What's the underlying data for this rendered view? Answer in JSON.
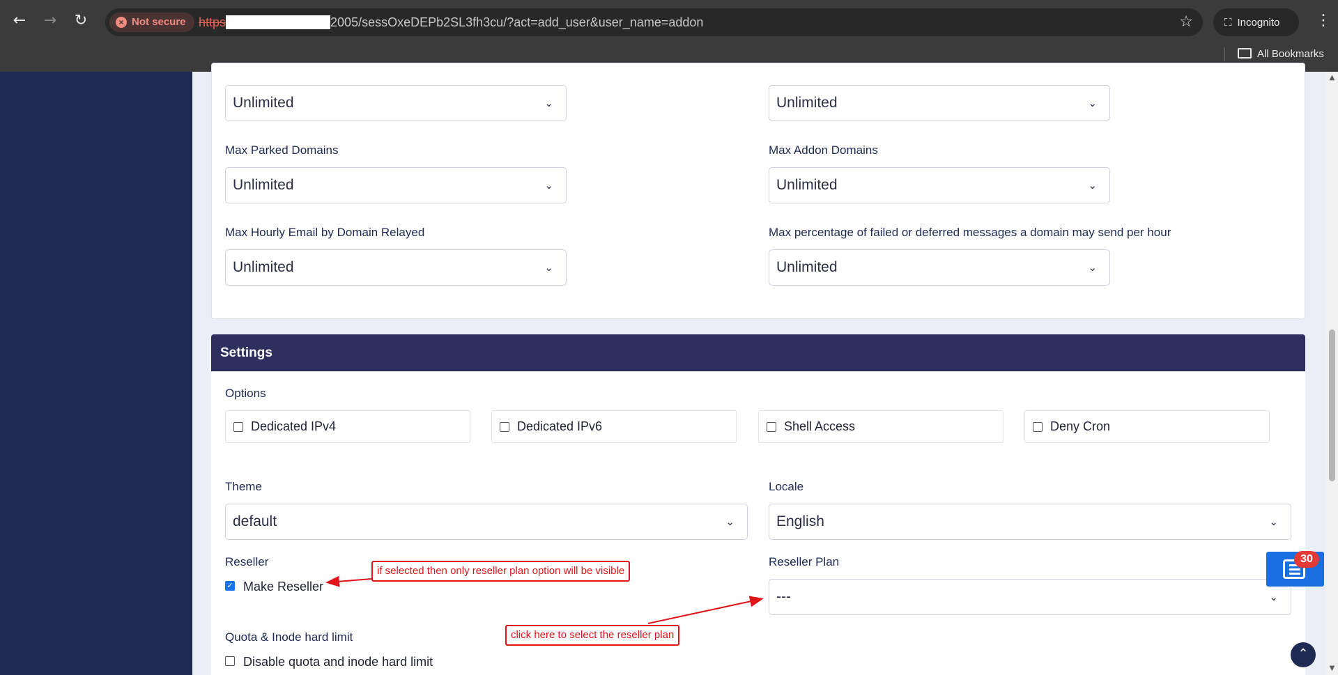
{
  "browser": {
    "security_chip": "Not secure",
    "url_scheme": "https",
    "url_path": "2005/sessOxeDEPb2SL3fh3cu/?act=add_user&user_name=addon",
    "incognito_label": "Incognito",
    "bookmarks_label": "All Bookmarks"
  },
  "limits": {
    "top_left_value": "Unlimited",
    "top_right_value": "Unlimited",
    "max_parked_domains": {
      "label": "Max Parked Domains",
      "value": "Unlimited"
    },
    "max_addon_domains": {
      "label": "Max Addon Domains",
      "value": "Unlimited"
    },
    "max_hourly_email": {
      "label": "Max Hourly Email by Domain Relayed",
      "value": "Unlimited"
    },
    "max_failed_percentage": {
      "label": "Max percentage of failed or deferred messages a domain may send per hour",
      "value": "Unlimited"
    }
  },
  "settings": {
    "header": "Settings",
    "options_label": "Options",
    "options": [
      {
        "label": "Dedicated IPv4",
        "checked": false
      },
      {
        "label": "Dedicated IPv6",
        "checked": false
      },
      {
        "label": "Shell Access",
        "checked": false
      },
      {
        "label": "Deny Cron",
        "checked": false
      }
    ],
    "theme": {
      "label": "Theme",
      "value": "default"
    },
    "locale": {
      "label": "Locale",
      "value": "English"
    },
    "reseller": {
      "label": "Reseller",
      "checkbox_label": "Make Reseller",
      "checked": true
    },
    "reseller_plan": {
      "label": "Reseller Plan",
      "value": "---"
    },
    "quota": {
      "label": "Quota & Inode hard limit",
      "checkbox_label": "Disable quota and inode hard limit",
      "checked": false
    }
  },
  "annotations": {
    "reseller_note": "if selected then only reseller plan option will be visible",
    "plan_note": "click here to select the reseller plan"
  },
  "widgets": {
    "notification_count": "30"
  },
  "colors": {
    "sidebar": "#1f2a52",
    "settings_header": "#2d2f5e",
    "annotation": "#e0151a",
    "float_button": "#1a6fe0"
  }
}
